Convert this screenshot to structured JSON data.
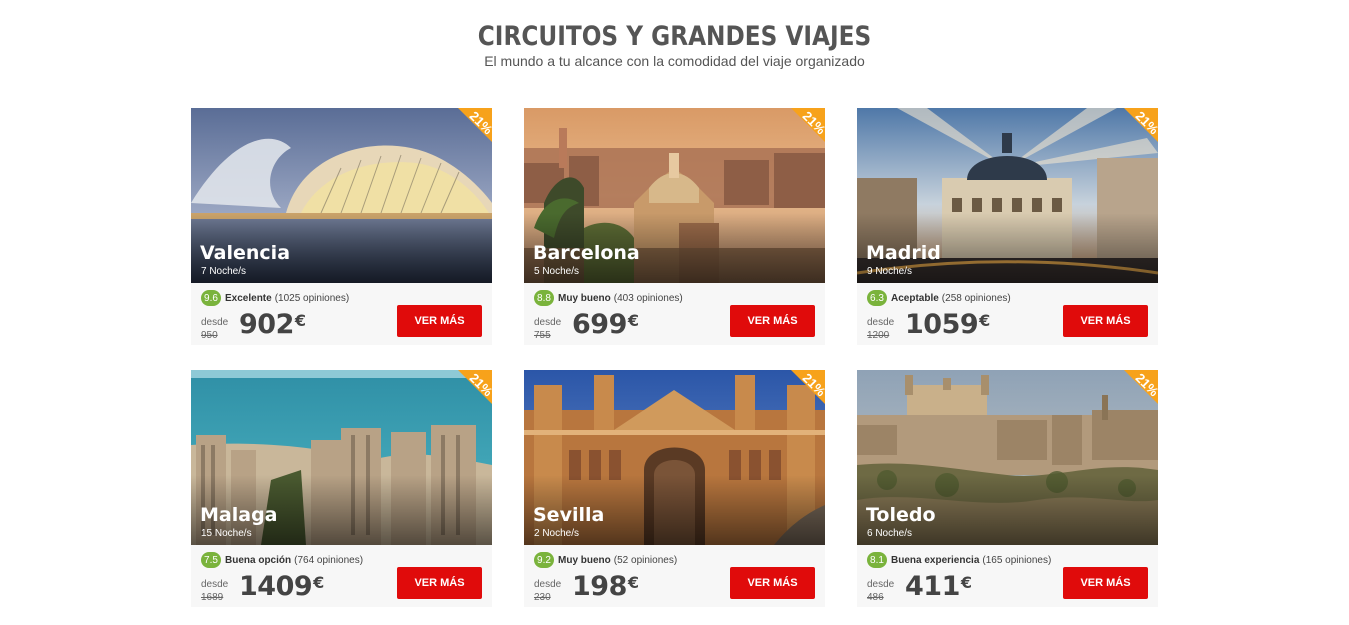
{
  "header": {
    "title": "CIRCUITOS Y GRANDES VIAJES",
    "subtitle": "El mundo a tu alcance con la comodidad del viaje organizado"
  },
  "cards": [
    {
      "city": "Valencia",
      "nights": "7 Noche/s",
      "discount": "21%",
      "score": "9.6",
      "rating_label": "Excelente",
      "opinions": "(1025 opiniones)",
      "desde": "desde",
      "old_price": "950",
      "price": "902",
      "currency": "€",
      "button": "VER MÁS"
    },
    {
      "city": "Barcelona",
      "nights": "5 Noche/s",
      "discount": "21%",
      "score": "8.8",
      "rating_label": "Muy bueno",
      "opinions": "(403 opiniones)",
      "desde": "desde",
      "old_price": "755",
      "price": "699",
      "currency": "€",
      "button": "VER MÁS"
    },
    {
      "city": "Madrid",
      "nights": "9 Noche/s",
      "discount": "21%",
      "score": "6.3",
      "rating_label": "Aceptable",
      "opinions": "(258 opiniones)",
      "desde": "desde",
      "old_price": "1200",
      "price": "1059",
      "currency": "€",
      "button": "VER MÁS"
    },
    {
      "city": "Malaga",
      "nights": "15 Noche/s",
      "discount": "21%",
      "score": "7.5",
      "rating_label": "Buena opción",
      "opinions": "(764 opiniones)",
      "desde": "desde",
      "old_price": "1689",
      "price": "1409",
      "currency": "€",
      "button": "VER MÁS"
    },
    {
      "city": "Sevilla",
      "nights": "2 Noche/s",
      "discount": "21%",
      "score": "9.2",
      "rating_label": "Muy bueno",
      "opinions": "(52 opiniones)",
      "desde": "desde",
      "old_price": "230",
      "price": "198",
      "currency": "€",
      "button": "VER MÁS"
    },
    {
      "city": "Toledo",
      "nights": "6 Noche/s",
      "discount": "21%",
      "score": "8.1",
      "rating_label": "Buena experiencia",
      "opinions": "(165 opiniones)",
      "desde": "desde",
      "old_price": "486",
      "price": "411",
      "currency": "€",
      "button": "VER MÁS"
    }
  ],
  "colors": {
    "accent_button": "#e00b0b",
    "discount_ribbon": "#f7a21b",
    "score_badge": "#7ab33c",
    "card_background": "#f7f7f7"
  }
}
